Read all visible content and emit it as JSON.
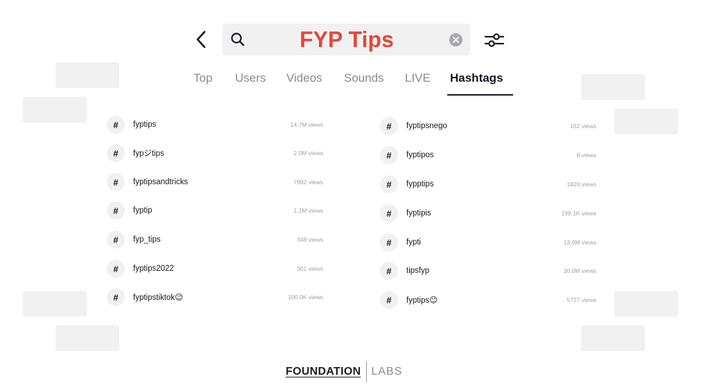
{
  "search": {
    "query": "FYP Tips"
  },
  "tabs": [
    {
      "label": "Top"
    },
    {
      "label": "Users"
    },
    {
      "label": "Videos"
    },
    {
      "label": "Sounds"
    },
    {
      "label": "LIVE"
    },
    {
      "label": "Hashtags",
      "active": true
    }
  ],
  "hashtags_left": [
    {
      "hash": "#",
      "tag": "fyptips",
      "views": "14.7M views"
    },
    {
      "hash": "#",
      "tag": "fypジtips",
      "views": "2.0M views"
    },
    {
      "hash": "#",
      "tag": "fyptipsandtricks",
      "views": "7992 views"
    },
    {
      "hash": "#",
      "tag": "fyptip",
      "views": "1.1M views"
    },
    {
      "hash": "#",
      "tag": "fyp_tips",
      "views": "348 views"
    },
    {
      "hash": "#",
      "tag": "fyptips2022",
      "views": "301 views"
    },
    {
      "hash": "#",
      "tag": "fyptipstiktok😉",
      "views": "100.0K views"
    }
  ],
  "hashtags_right": [
    {
      "hash": "#",
      "tag": "fyptipsnego",
      "views": "162 views"
    },
    {
      "hash": "#",
      "tag": "fyptipos",
      "views": "8 views"
    },
    {
      "hash": "#",
      "tag": "fypptips",
      "views": "1820 views"
    },
    {
      "hash": "#",
      "tag": "fyptipis",
      "views": "199.1K views"
    },
    {
      "hash": "#",
      "tag": "fypti",
      "views": "13.9M views"
    },
    {
      "hash": "#",
      "tag": "tipsfyp",
      "views": "30.0M views"
    },
    {
      "hash": "#",
      "tag": "fyptips😉",
      "views": "5727 views"
    }
  ],
  "footer": {
    "brand": "FOUNDATION",
    "sub": "LABS"
  },
  "colors": {
    "query": "#e2493a",
    "tab_active": "#161823",
    "tab_inactive": "#8a8b91",
    "placeholder_box": "#f1f1f2"
  },
  "icons": [
    "back-arrow-icon",
    "search-icon",
    "clear-icon",
    "filter-sliders-icon",
    "hashtag-icon"
  ]
}
